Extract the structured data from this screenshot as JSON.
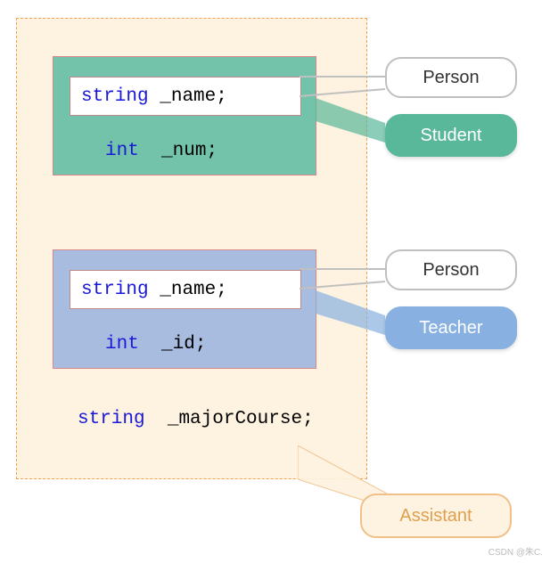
{
  "classes": {
    "student": {
      "name_field": {
        "type": "string",
        "name": "_name",
        "punct": ";"
      },
      "num_field": {
        "type": "int",
        "name": "_num",
        "punct": ";"
      }
    },
    "teacher": {
      "name_field": {
        "type": "string",
        "name": "_name",
        "punct": ";"
      },
      "id_field": {
        "type": "int",
        "name": "_id",
        "punct": ";"
      }
    },
    "assistant": {
      "major_field": {
        "type": "string",
        "name": "_majorCourse",
        "punct": ";"
      }
    }
  },
  "labels": {
    "person1": "Person",
    "student": "Student",
    "person2": "Person",
    "teacher": "Teacher",
    "assistant": "Assistant"
  },
  "watermark": "CSDN @朱C.",
  "chart_data": {
    "type": "diagram",
    "description": "C++ class inheritance diagram showing diamond inheritance problem",
    "classes": [
      {
        "name": "Person",
        "fields": [
          "string _name"
        ]
      },
      {
        "name": "Student",
        "inherits": [
          "Person"
        ],
        "fields": [
          "int _num"
        ]
      },
      {
        "name": "Teacher",
        "inherits": [
          "Person"
        ],
        "fields": [
          "int _id"
        ]
      },
      {
        "name": "Assistant",
        "inherits": [
          "Student",
          "Teacher"
        ],
        "fields": [
          "string _majorCourse"
        ]
      }
    ]
  }
}
